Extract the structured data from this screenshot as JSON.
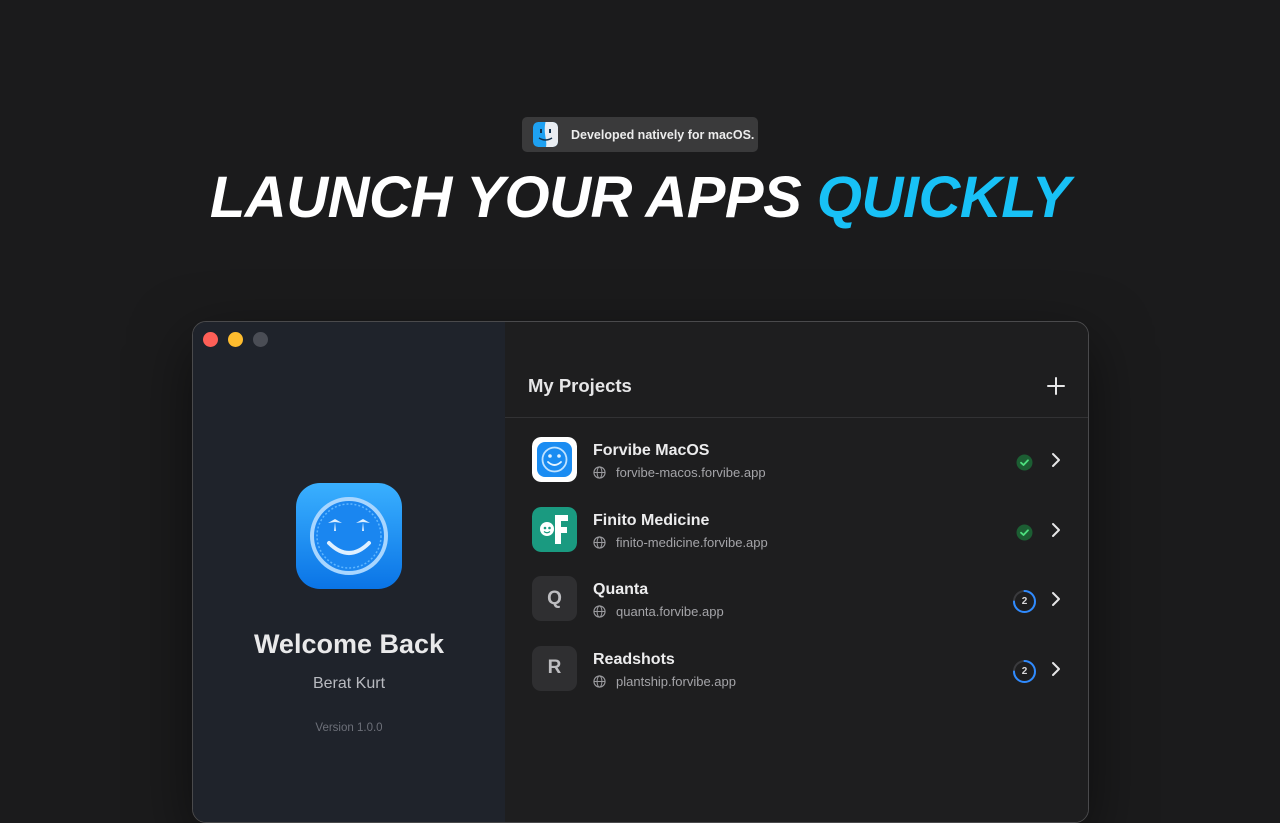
{
  "badge": {
    "icon": "finder-icon",
    "text": "Developed natively for macOS."
  },
  "headline": {
    "main": "LAUNCH YOUR APPS",
    "accent": "QUICKLY",
    "accent_color": "#18c1f6"
  },
  "window": {
    "traffic_lights": [
      "close",
      "minimize",
      "zoom"
    ],
    "sidebar": {
      "app_icon": "smiley-palm-app-icon",
      "welcome": "Welcome Back",
      "user": "Berat Kurt",
      "version": "Version 1.0.0"
    },
    "main": {
      "title": "My Projects",
      "add_icon": "plus-icon",
      "projects": [
        {
          "name": "Forvibe MacOS",
          "url": "forvibe-macos.forvibe.app",
          "icon": "forvibe-app-icon",
          "status": "success",
          "status_label": ""
        },
        {
          "name": "Finito Medicine",
          "url": "finito-medicine.forvibe.app",
          "icon": "finito-app-icon",
          "status": "success",
          "status_label": ""
        },
        {
          "name": "Quanta",
          "url": "quanta.forvibe.app",
          "icon_letter": "Q",
          "status": "progress",
          "status_label": "2"
        },
        {
          "name": "Readshots",
          "url": "plantship.forvibe.app",
          "icon_letter": "R",
          "status": "progress",
          "status_label": "2"
        }
      ]
    }
  },
  "colors": {
    "background": "#1b1b1c",
    "sidebar": "#1f232b",
    "success": "#1e9e4a",
    "progress": "#2f8bff"
  }
}
